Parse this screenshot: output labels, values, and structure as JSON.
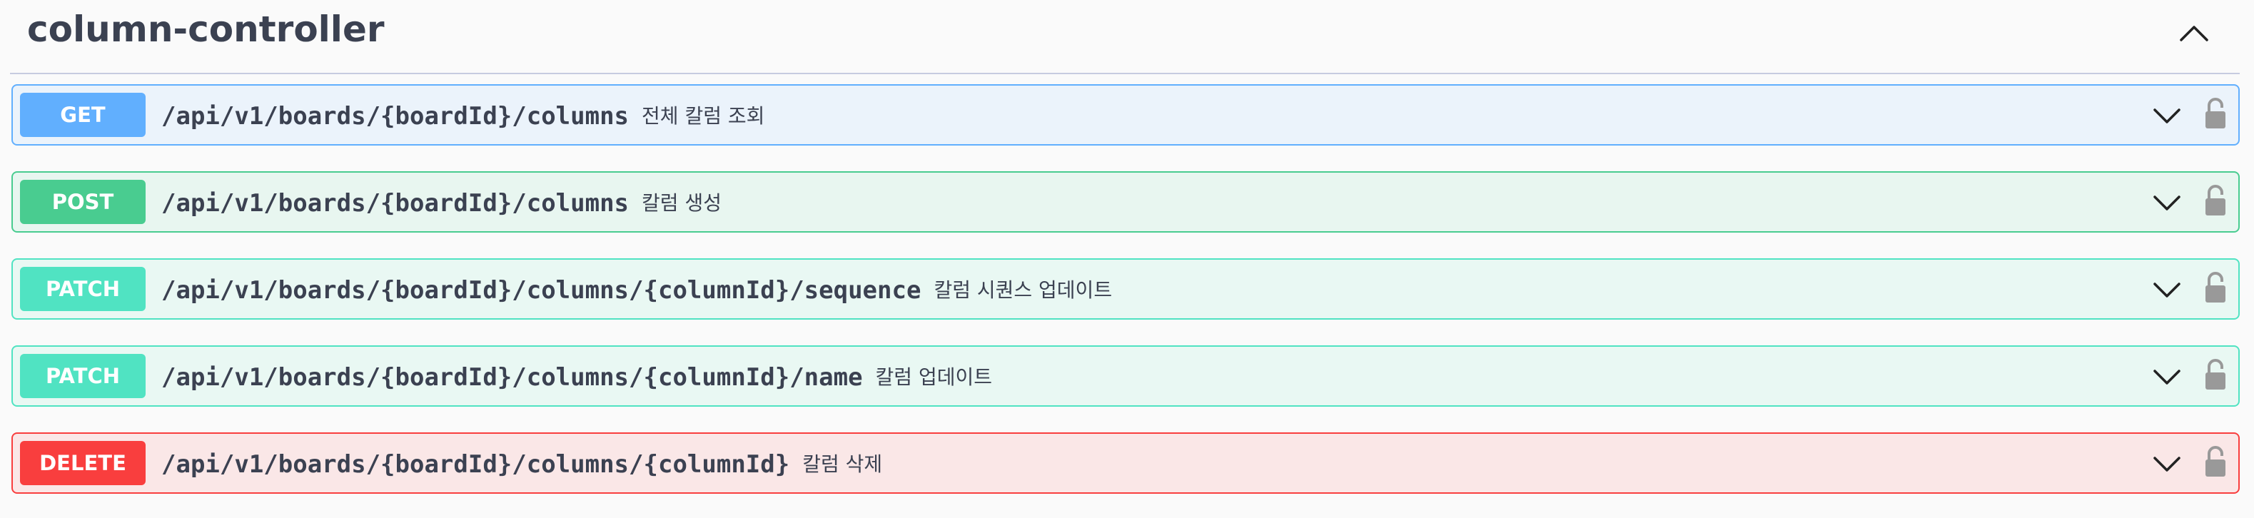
{
  "section": {
    "title": "column-controller",
    "collapse_icon": "chevron-up-icon"
  },
  "operations": [
    {
      "method": "GET",
      "path": "/api/v1/boards/{boardId}/columns",
      "summary": "전체 칼럼 조회"
    },
    {
      "method": "POST",
      "path": "/api/v1/boards/{boardId}/columns",
      "summary": "칼럼 생성"
    },
    {
      "method": "PATCH",
      "path": "/api/v1/boards/{boardId}/columns/{columnId}/sequence",
      "summary": "칼럼 시퀀스 업데이트"
    },
    {
      "method": "PATCH",
      "path": "/api/v1/boards/{boardId}/columns/{columnId}/name",
      "summary": "칼럼 업데이트"
    },
    {
      "method": "DELETE",
      "path": "/api/v1/boards/{boardId}/columns/{columnId}",
      "summary": "칼럼 삭제"
    }
  ],
  "colors": {
    "get": "#61affe",
    "post": "#49cc90",
    "patch": "#50e3c2",
    "delete": "#f93e3e",
    "text": "#3b4151",
    "lock": "#999999"
  },
  "icons": {
    "expand": "chevron-down-icon",
    "auth": "lock-icon"
  }
}
